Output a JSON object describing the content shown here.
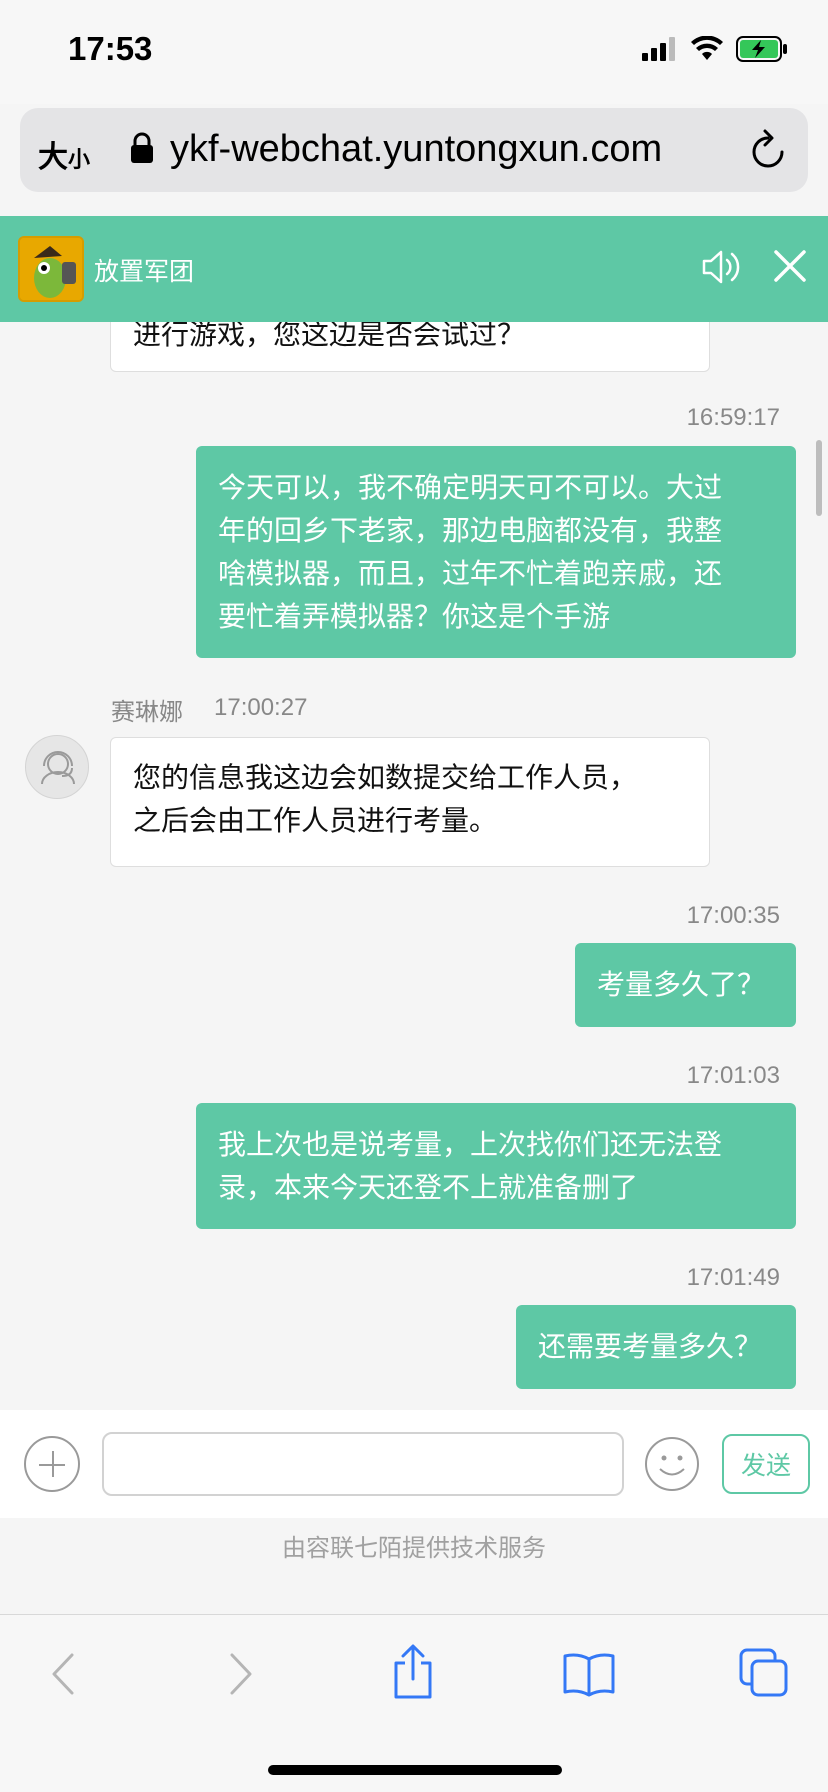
{
  "status_bar": {
    "time": "17:53"
  },
  "browser": {
    "text_size_label_big": "大",
    "text_size_label_small": "小",
    "url": "ykf-webchat.yuntongxun.com"
  },
  "chat_header": {
    "title": "放置军团",
    "accent_color": "#5ec8a5"
  },
  "messages": {
    "m0": {
      "text": "进行游戏，您这边是否会试过？"
    },
    "m1": {
      "timestamp": "16:59:17",
      "lines": [
        "今天可以，我不确定明天可不可以。大过",
        "年的回乡下老家，那边电脑都没有，我整",
        "啥模拟器，而且，过年不忙着跑亲戚，还",
        "要忙着弄模拟器？你这是个手游"
      ]
    },
    "m2": {
      "agent_name": "赛琳娜",
      "timestamp": "17:00:27",
      "lines": [
        "您的信息我这边会如数提交给工作人员，",
        "之后会由工作人员进行考量。"
      ]
    },
    "m3": {
      "timestamp": "17:00:35",
      "text": "考量多久了？"
    },
    "m4": {
      "timestamp": "17:01:03",
      "lines": [
        "我上次也是说考量，上次找你们还无法登",
        "录，本来今天还登不上就准备删了"
      ]
    },
    "m5": {
      "timestamp": "17:01:49",
      "text": "还需要考量多久？"
    }
  },
  "input": {
    "placeholder": "",
    "send_label": "发送"
  },
  "footer": {
    "powered_by": "由容联七陌提供技术服务"
  },
  "icons": [
    "lock-icon",
    "reload-icon",
    "game-logo",
    "sound-icon",
    "close-icon",
    "agent-avatar-icon",
    "plus-icon",
    "emoji-icon",
    "back-icon",
    "forward-icon",
    "share-icon",
    "bookmarks-icon",
    "tabs-icon"
  ]
}
